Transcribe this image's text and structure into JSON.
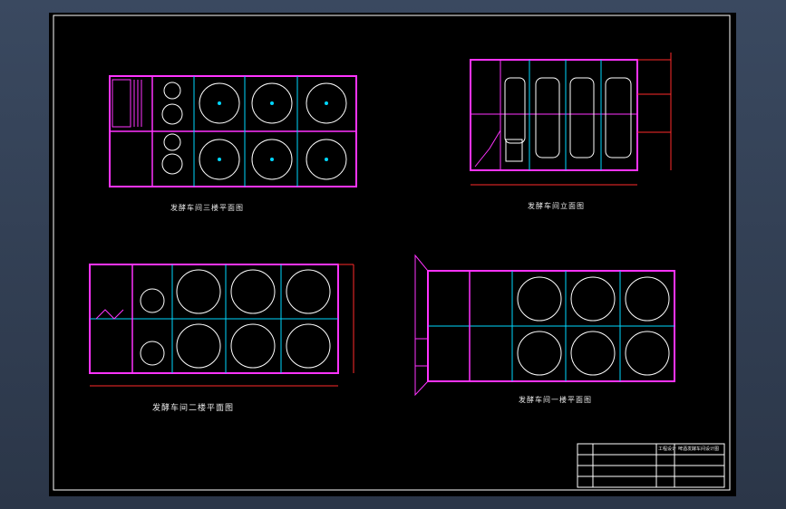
{
  "drawing": {
    "titles": {
      "third_floor_plan": "发酵车间三楼平面图",
      "elevation": "发酵车间立面图",
      "second_floor_plan": "发酵车间二楼平面图",
      "first_floor_plan": "发酵车间一楼平面图"
    },
    "colors": {
      "background": "#000000",
      "frame": "#ffffff",
      "wall": "#ff33ff",
      "grid": "#00d7ff",
      "tank": "#ffffff",
      "dimension": "#ff2a2a"
    },
    "title_block": {
      "company": "工程设计",
      "project": "啤酒发酵车间设计图"
    }
  }
}
